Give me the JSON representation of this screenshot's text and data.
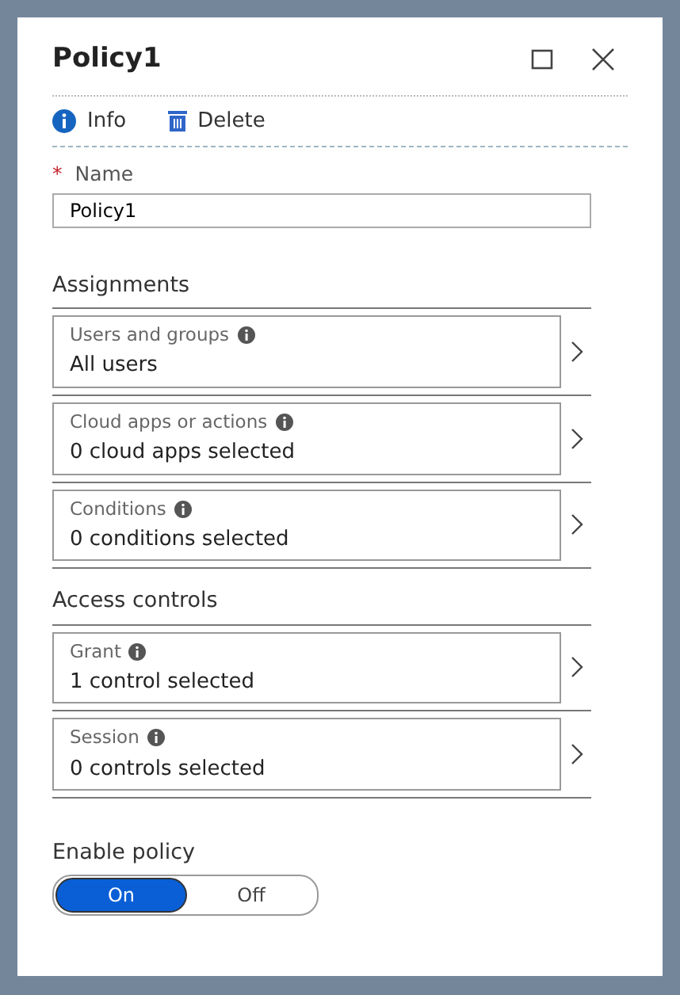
{
  "window": {
    "title": "Policy1"
  },
  "toolbar": [
    {
      "kind": "info",
      "label": "Info"
    },
    {
      "kind": "delete",
      "label": "Delete"
    }
  ],
  "name_field": {
    "label": "Name",
    "required_mark": "*",
    "value": "Policy1"
  },
  "sections": [
    {
      "title": "Assignments",
      "items": [
        {
          "label": "Users and groups",
          "value": "All users"
        },
        {
          "label": "Cloud apps or actions",
          "value": "0 cloud apps selected"
        },
        {
          "label": "Conditions",
          "value": "0 conditions selected"
        }
      ]
    },
    {
      "title": "Access controls",
      "items": [
        {
          "label": "Grant",
          "value": "1 control selected"
        },
        {
          "label": "Session",
          "value": "0 controls selected"
        }
      ]
    }
  ],
  "enable_policy": {
    "label": "Enable policy",
    "options": [
      {
        "label": "On",
        "selected": true
      },
      {
        "label": "Off",
        "selected": false
      }
    ]
  }
}
